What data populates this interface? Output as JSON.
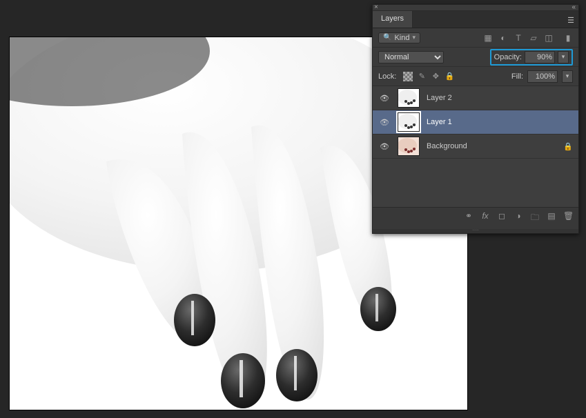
{
  "panel": {
    "tab_label": "Layers",
    "filter": {
      "kind_label": "Kind",
      "icons": [
        "image-icon",
        "adjust-icon",
        "type-icon",
        "shape-icon",
        "smart-icon"
      ]
    },
    "blend": {
      "mode": "Normal",
      "opacity_label": "Opacity:",
      "opacity_value": "90%"
    },
    "lock": {
      "label": "Lock:",
      "fill_label": "Fill:",
      "fill_value": "100%"
    },
    "layers": [
      {
        "name": "Layer 2",
        "visible": true,
        "selected": false,
        "locked": false
      },
      {
        "name": "Layer 1",
        "visible": true,
        "selected": true,
        "locked": false
      },
      {
        "name": "Background",
        "visible": true,
        "selected": false,
        "locked": true
      }
    ],
    "footer_icons": [
      "link-icon",
      "fx-icon",
      "mask-icon",
      "adjustment-icon",
      "group-icon",
      "new-layer-icon",
      "trash-icon"
    ]
  }
}
